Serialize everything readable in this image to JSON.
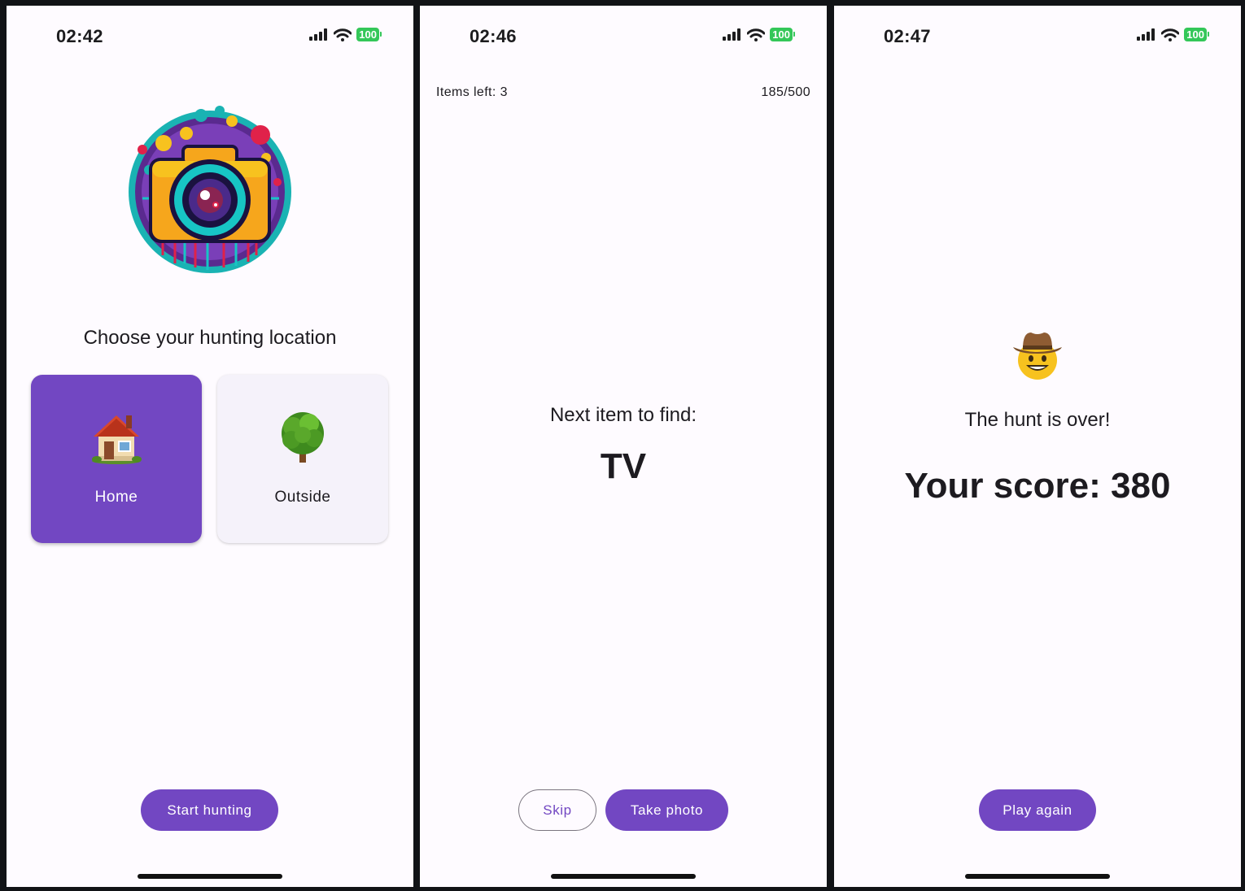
{
  "screens": [
    {
      "status": {
        "time": "02:42",
        "battery": "100"
      }
    },
    {
      "status": {
        "time": "02:46",
        "battery": "100"
      }
    },
    {
      "status": {
        "time": "02:47",
        "battery": "100"
      }
    }
  ],
  "select_screen": {
    "title": "Choose your hunting location",
    "locations": [
      {
        "label": "Home",
        "icon": "house-emoji-icon",
        "selected": true
      },
      {
        "label": "Outside",
        "icon": "tree-emoji-icon",
        "selected": false
      }
    ],
    "start_label": "Start hunting"
  },
  "hunt_screen": {
    "items_left": "Items left: 3",
    "score": "185/500",
    "prompt": "Next item to find:",
    "item": "TV",
    "skip_label": "Skip",
    "photo_label": "Take photo"
  },
  "result_screen": {
    "message": "The hunt is over!",
    "score_text": "Your score: 380",
    "play_again_label": "Play again"
  },
  "colors": {
    "accent": "#7247c2",
    "background": "#fefbff",
    "card_unselected": "#f5f2fa",
    "battery": "#34c759"
  }
}
